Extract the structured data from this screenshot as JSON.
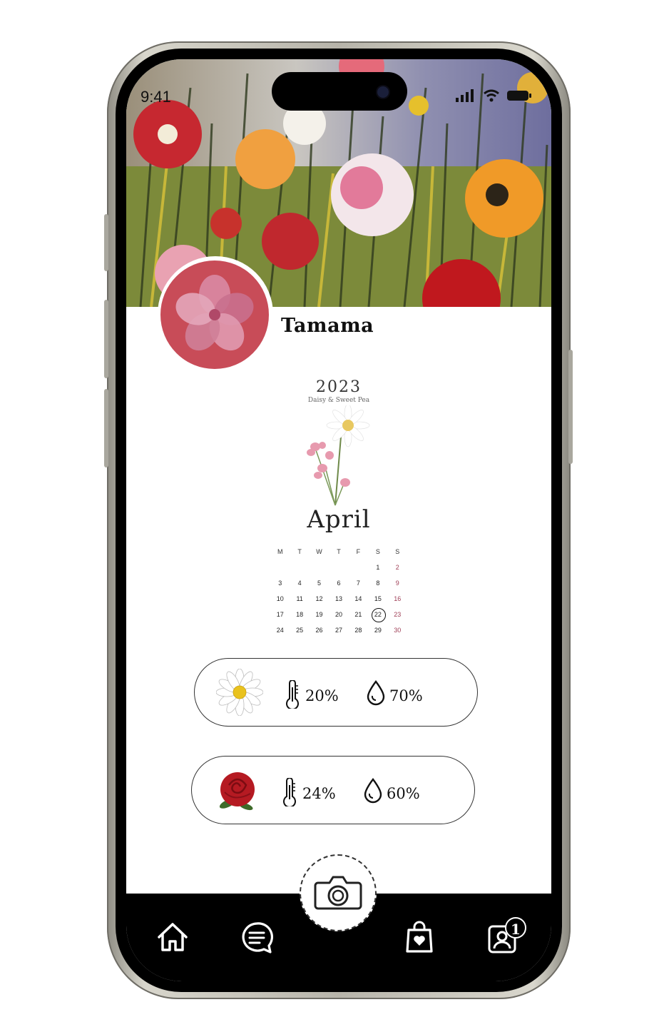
{
  "status_bar": {
    "time": "9:41"
  },
  "profile": {
    "name": "Tamama"
  },
  "calendar": {
    "year": "2023",
    "subtitle": "Daisy & Sweet Pea",
    "month": "April",
    "weekday_headers": [
      "M",
      "T",
      "W",
      "T",
      "F",
      "S",
      "S"
    ],
    "weeks": [
      [
        "",
        "",
        "",
        "",
        "",
        "1",
        "2"
      ],
      [
        "3",
        "4",
        "5",
        "6",
        "7",
        "8",
        "9"
      ],
      [
        "10",
        "11",
        "12",
        "13",
        "14",
        "15",
        "16"
      ],
      [
        "17",
        "18",
        "19",
        "20",
        "21",
        "22",
        "23"
      ],
      [
        "24",
        "25",
        "26",
        "27",
        "28",
        "29",
        "30"
      ]
    ],
    "selected_day": "22"
  },
  "plants": [
    {
      "icon": "daisy-icon",
      "temperature": "20%",
      "humidity": "70%"
    },
    {
      "icon": "rose-icon",
      "temperature": "24%",
      "humidity": "60%"
    }
  ],
  "nav": {
    "items": [
      "home-icon",
      "chat-icon",
      "camera-icon",
      "shopping-bag-icon",
      "profile-icon"
    ],
    "profile_badge": "1"
  },
  "colors": {
    "avatar_bg": "#c84c58",
    "accent_red": "#c0282e",
    "background": "#ffffff",
    "tabbar": "#000000"
  }
}
